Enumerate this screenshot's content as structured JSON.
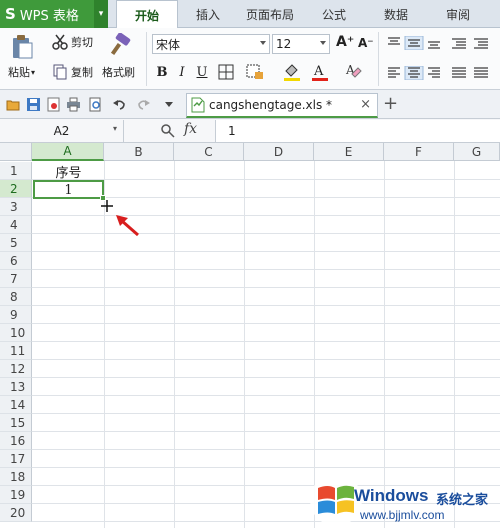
{
  "app": {
    "logo": "S",
    "name": "WPS 表格",
    "drop": "▾"
  },
  "tabs": [
    {
      "label": "开始",
      "active": true
    },
    {
      "label": "插入",
      "active": false
    },
    {
      "label": "页面布局",
      "active": false
    },
    {
      "label": "公式",
      "active": false
    },
    {
      "label": "数据",
      "active": false
    },
    {
      "label": "审阅",
      "active": false
    }
  ],
  "ribbon": {
    "cut_label": "剪切",
    "paste_label": "粘贴",
    "copy_label": "复制",
    "format_painter_label": "格式刷",
    "font_name": "宋体",
    "font_size": "12",
    "bold": "B",
    "italic": "I",
    "underline": "U",
    "grow": "A⁺",
    "shrink": "A⁻"
  },
  "document": {
    "tab_name": "cangshengtage.xls *",
    "close": "×",
    "new_tab": "+"
  },
  "formula_bar": {
    "cell_ref": "A2",
    "fx": "fx",
    "value": "1"
  },
  "grid": {
    "columns": [
      "A",
      "B",
      "C",
      "D",
      "E",
      "F",
      "G"
    ],
    "selected_column": "A",
    "rows": [
      "1",
      "2",
      "3",
      "4",
      "5",
      "6",
      "7",
      "8",
      "9",
      "10",
      "11",
      "12",
      "13",
      "14",
      "15",
      "16",
      "17",
      "18",
      "19",
      "20"
    ],
    "selected_row": "2",
    "cells": {
      "A1": "序号",
      "A2": "1"
    }
  },
  "watermark": {
    "brand": "Windows",
    "cn": "系统之家",
    "url": "www.bjjmlv.com"
  },
  "colors": {
    "accent": "#4d9b45",
    "app_green": "#3f9a3b",
    "arrow_red": "#d81e1e",
    "watermark_blue": "#1a4d9c"
  }
}
